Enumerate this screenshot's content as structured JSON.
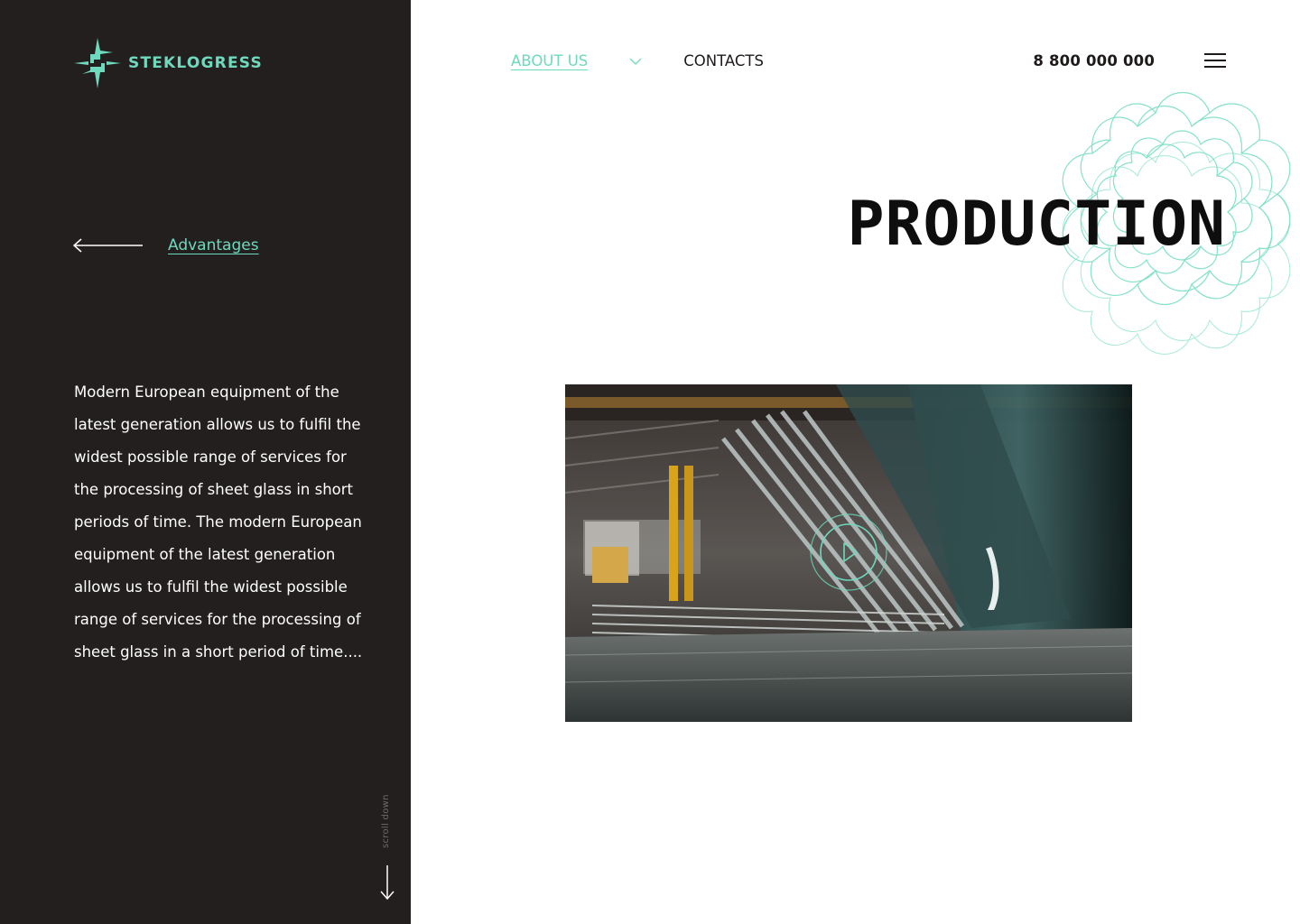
{
  "brand": {
    "name": "STEKLOGRESS",
    "logo_icon": "steklogress-emblem-icon",
    "accent_color": "#6ed9bd",
    "sidebar_color": "#231f1f"
  },
  "sidebar": {
    "back_link_label": "Advantages",
    "description": "Modern European equipment of the latest generation allows us to fulfil the widest possible range of services for the processing of sheet glass in short periods of time. The modern European equipment of the latest generation allows us to fulfil the widest possible range of services for the processing of sheet glass in a short period of time....",
    "scroll_hint": "scroll down"
  },
  "nav": {
    "items": [
      {
        "label": "ABOUT US",
        "active": true,
        "has_dropdown": true
      },
      {
        "label": "CONTACTS",
        "active": false
      }
    ],
    "phone": "8 800 000 000",
    "menu_icon": "hamburger-menu-icon"
  },
  "main": {
    "title": "PRODUCTION",
    "video": {
      "thumbnail": "glass-production-workshop",
      "play_icon": "play-icon"
    }
  }
}
